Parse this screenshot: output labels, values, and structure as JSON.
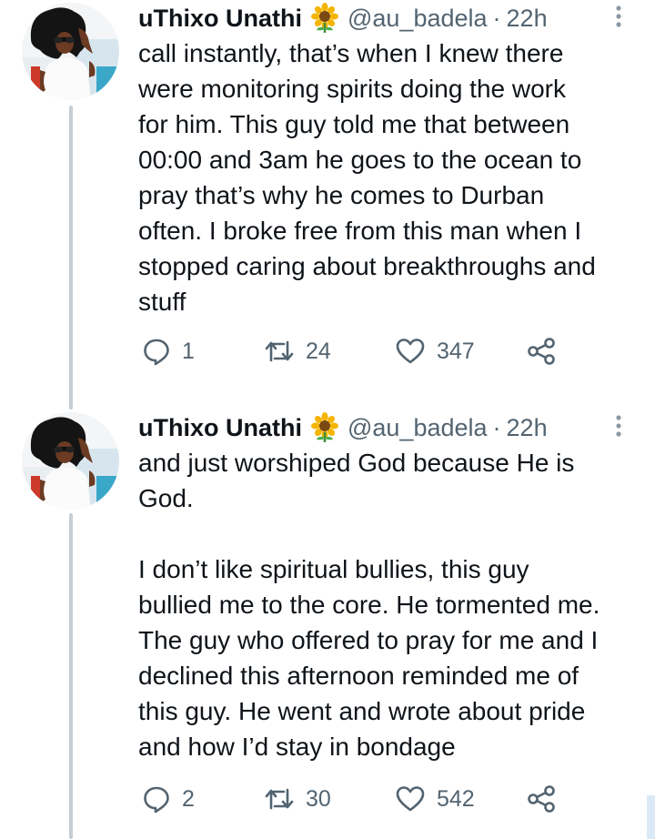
{
  "accent_color": "#536471",
  "thread_line_color": "#c4cfd6",
  "tweets": [
    {
      "author": {
        "display_name": "uThixo Unathi",
        "emoji": "sunflower-emoji",
        "handle": "@au_badela",
        "separator": "·",
        "time": "22h"
      },
      "text": "call instantly, that’s when I knew there\nwere monitoring spirits doing the work\nfor him. This guy told me that between\n00:00 and 3am he goes to the ocean to\npray that’s why he comes to Durban\noften. I broke free from this man when I\nstopped caring about breakthroughs and\nstuff",
      "actions": {
        "reply_count": "1",
        "retweet_count": "24",
        "like_count": "347"
      }
    },
    {
      "author": {
        "display_name": "uThixo Unathi",
        "emoji": "sunflower-emoji",
        "handle": "@au_badela",
        "separator": "·",
        "time": "22h"
      },
      "text": "and just worshiped God because He is\nGod.\n\nI don’t like spiritual bullies, this guy\nbullied me to the core. He tormented me.\nThe guy who offered to pray for me and I\ndeclined this afternoon reminded me of\nthis guy. He went and wrote about pride\nand how I’d stay in bondage",
      "actions": {
        "reply_count": "2",
        "retweet_count": "30",
        "like_count": "542"
      }
    }
  ]
}
